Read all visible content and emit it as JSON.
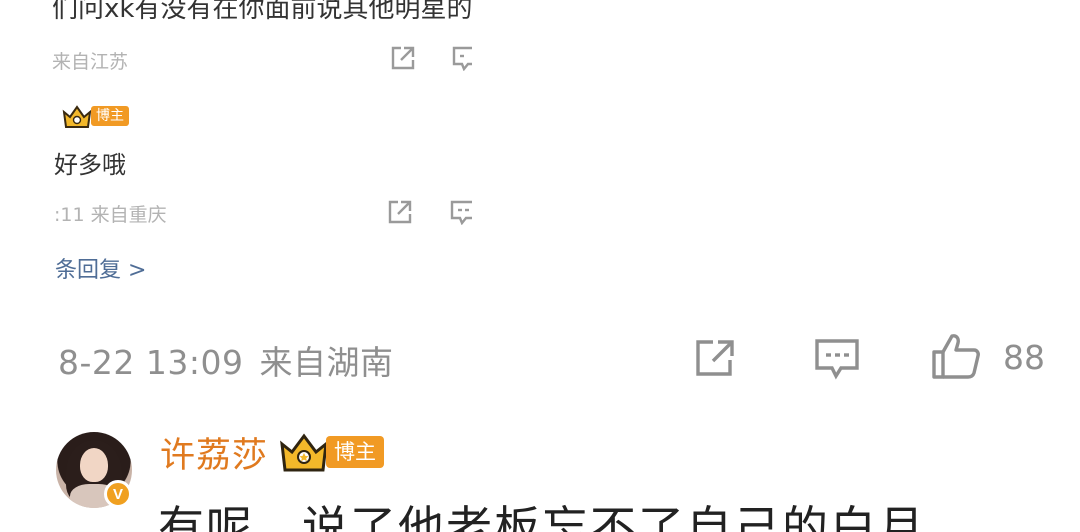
{
  "inset_reply_panel": {
    "line1_text": "们问xk有没有在你面前说其他明星的",
    "reply1_meta": "来自江苏",
    "reply2_author": "",
    "reply2_badge": "博主",
    "reply2_text": "好多哦",
    "reply2_meta": ":11 来自重庆",
    "more_replies": "条回复 >"
  },
  "comment": {
    "date_time": "8-22 13:09",
    "location": "来自湖南",
    "like_count": "88",
    "author": {
      "name": "许荔莎",
      "badge_label": "博主",
      "verified_mark": "V"
    },
    "text": "有呢，说了他老板忘不了自己的白月"
  },
  "colors": {
    "username": "#e07a1f",
    "badge_bg": "#f19a24",
    "meta_gray": "#8f8f8f",
    "link_blue": "#4f6d96"
  },
  "icons": [
    "share-icon",
    "comment-icon",
    "like-icon",
    "crown-icon",
    "verified-icon"
  ]
}
